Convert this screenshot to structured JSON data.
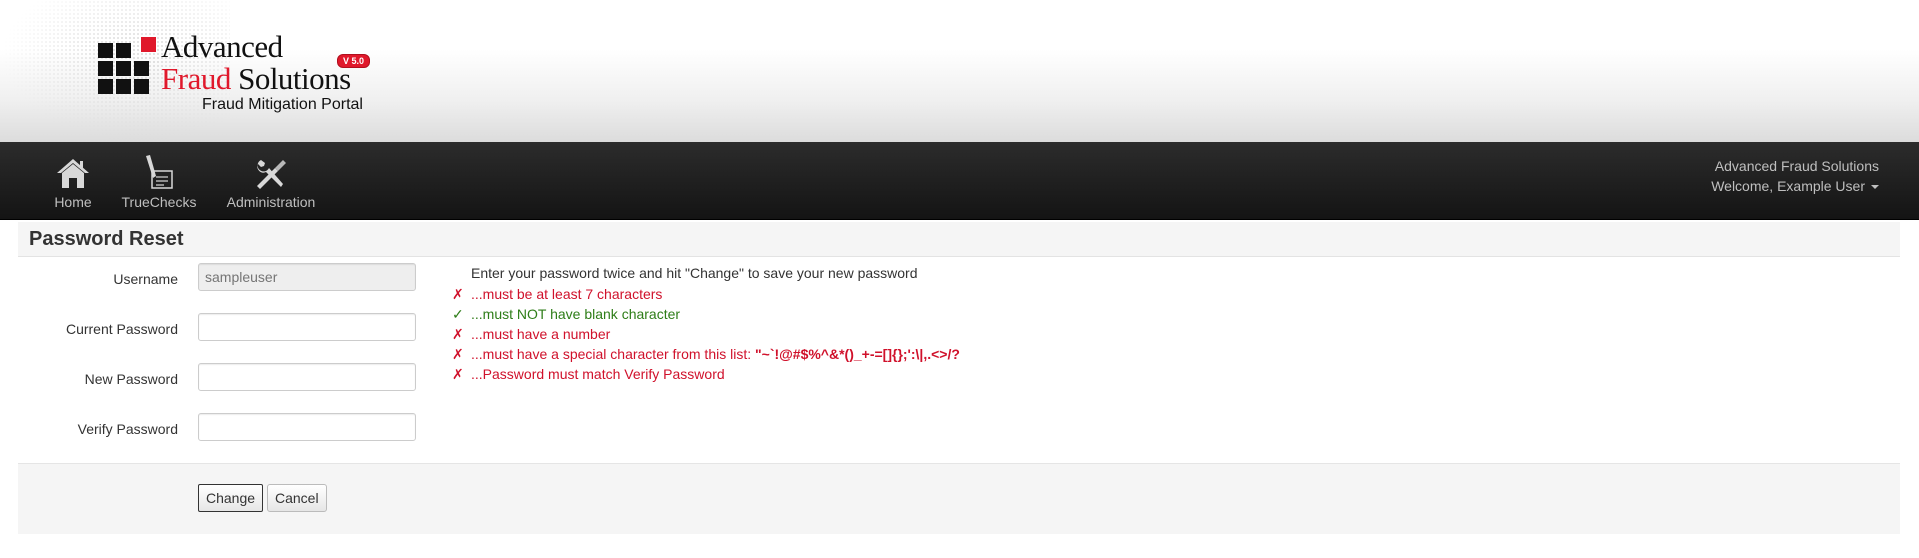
{
  "header": {
    "logo_line1": "Advanced",
    "logo_line2_red": "Fraud",
    "logo_line2_black": " Solutions",
    "version": "V 5.0",
    "tagline": "Fraud Mitigation Portal",
    "brand_colors": {
      "red": "#e0182b",
      "black": "#111111"
    }
  },
  "nav": {
    "items": [
      {
        "label": "Home",
        "icon": "house-icon"
      },
      {
        "label": "TrueChecks",
        "icon": "check-writing-icon"
      },
      {
        "label": "Administration",
        "icon": "wrench-screwdriver-icon"
      }
    ],
    "company": "Advanced Fraud Solutions",
    "welcome": "Welcome, Example User"
  },
  "page": {
    "title": "Password Reset"
  },
  "form": {
    "username_label": "Username",
    "username_placeholder": "sampleuser",
    "current_password_label": "Current Password",
    "new_password_label": "New Password",
    "verify_password_label": "Verify Password"
  },
  "rules": {
    "intro": "Enter your password twice and hit \"Change\" to save your new password",
    "items": [
      {
        "mark": "✗",
        "status": "fail",
        "text": "...must be at least 7 characters"
      },
      {
        "mark": "✓",
        "status": "pass",
        "text": "...must NOT have blank character"
      },
      {
        "mark": "✗",
        "status": "fail",
        "text": "...must have a number"
      },
      {
        "mark": "✗",
        "status": "fail",
        "text": "...must have a special character from this list: ",
        "chars": "\"~`!@#$%^&*()_+-=[]{};':\\|,.<>/?"
      },
      {
        "mark": "✗",
        "status": "fail",
        "text": "...Password must match Verify Password"
      }
    ],
    "colors": {
      "fail": "#d0112b",
      "pass": "#2e7d18"
    }
  },
  "actions": {
    "change_label": "Change",
    "cancel_label": "Cancel"
  }
}
